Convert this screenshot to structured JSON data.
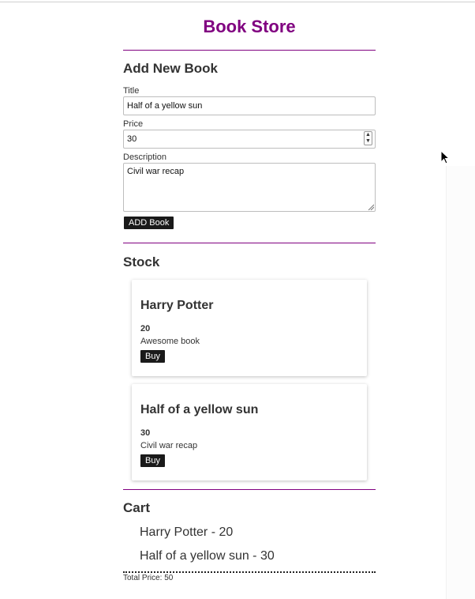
{
  "header": {
    "title": "Book Store"
  },
  "add_form": {
    "heading": "Add New Book",
    "title_label": "Title",
    "title_value": "Half of a yellow sun",
    "price_label": "Price",
    "price_value": "30",
    "description_label": "Description",
    "description_value": "Civil war recap",
    "submit_label": "ADD Book"
  },
  "stock": {
    "heading": "Stock",
    "books": [
      {
        "title": "Harry Potter",
        "price": "20",
        "description": "Awesome book",
        "buy_label": "Buy"
      },
      {
        "title": "Half of a yellow sun",
        "price": "30",
        "description": "Civil war recap",
        "buy_label": "Buy"
      }
    ]
  },
  "cart": {
    "heading": "Cart",
    "items": [
      "Harry Potter - 20",
      "Half of a yellow sun - 30"
    ],
    "total": "Total Price: 50"
  },
  "colors": {
    "accent": "#800080",
    "button_bg": "#1a1a1a",
    "divider": "#800080"
  }
}
